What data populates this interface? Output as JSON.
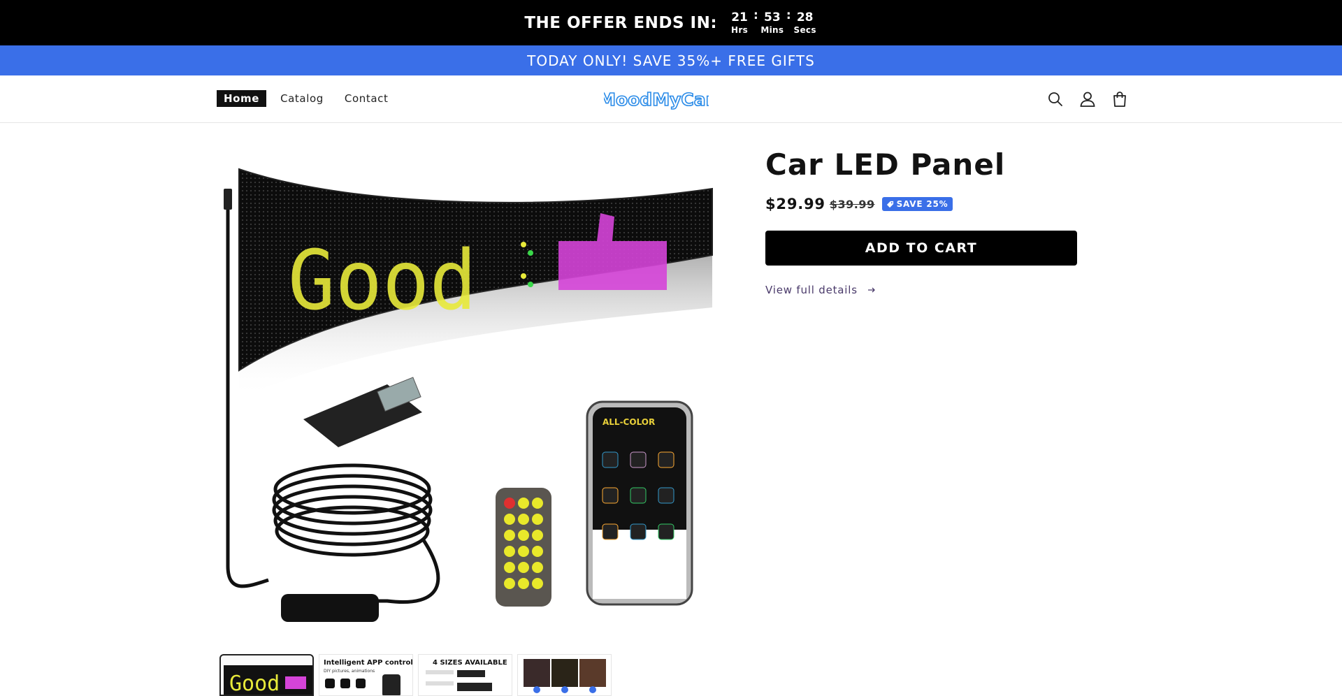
{
  "countdown": {
    "title": "THE OFFER ENDS IN:",
    "hours": "21",
    "hours_label": "Hrs",
    "minutes": "53",
    "minutes_label": "Mins",
    "seconds": "28",
    "seconds_label": "Secs",
    "separator": ":"
  },
  "announcement": {
    "text": "TODAY ONLY! SAVE 35%+ FREE GIFTS",
    "color": "#3a6fe8"
  },
  "nav": {
    "items": [
      {
        "label": "Home",
        "active": true
      },
      {
        "label": "Catalog"
      },
      {
        "label": "Contact"
      }
    ]
  },
  "logo": {
    "text": "MoodMyCar",
    "color": "#2a8be8"
  },
  "header_icons": [
    "search-icon",
    "account-icon",
    "cart-icon"
  ],
  "product": {
    "title": "Car LED Panel",
    "price": "$29.99",
    "compare_price": "$39.99",
    "save_badge": "SAVE 25%",
    "add_to_cart": "ADD TO CART",
    "view_details": "View full details",
    "media_led_text": "Good",
    "phone_app_title": "ALL-COLOR"
  },
  "thumbnails": [
    {
      "caption": "Good",
      "selected": true
    },
    {
      "caption": "Intelligent APP control",
      "subcaption": "DIY pictures, animations"
    },
    {
      "caption": "4 SIZES AVAILABLE"
    },
    {
      "caption": ""
    }
  ]
}
